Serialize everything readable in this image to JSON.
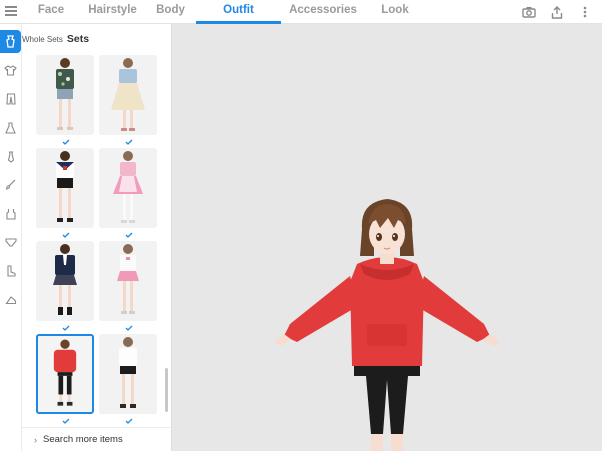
{
  "tabs": [
    "Face",
    "Hairstyle",
    "Body",
    "Outfit",
    "Accessories",
    "Look"
  ],
  "active_tab": "Outfit",
  "toolbar": {
    "menu_icon": "hamburger-menu-icon",
    "camera_icon": "camera-icon",
    "share_icon": "share-icon",
    "more_icon": "more-vertical-icon"
  },
  "rail": {
    "items": [
      "sets-icon",
      "shirt-icon",
      "pants-icon",
      "dress-icon",
      "tie-icon",
      "brush-icon",
      "tank-top-icon",
      "underwear-icon",
      "boots-icon",
      "shoes-icon"
    ],
    "active_index": 0
  },
  "panel": {
    "breadcrumb": "Whole Sets",
    "title": "Sets",
    "search_more": "Search more items",
    "items": [
      {
        "name": "floral-shirt-shorts",
        "selected": false
      },
      {
        "name": "denim-jacket-cream-skirt",
        "selected": false
      },
      {
        "name": "sailor-uniform-black-shorts",
        "selected": false
      },
      {
        "name": "pink-maid-dress",
        "selected": false
      },
      {
        "name": "navy-blazer-plaid-skirt",
        "selected": false
      },
      {
        "name": "white-top-pink-skirt",
        "selected": false
      },
      {
        "name": "red-hoodie-black-leggings",
        "selected": true
      },
      {
        "name": "white-tee-black-shorts",
        "selected": false
      }
    ]
  },
  "colors": {
    "accent": "#1e88e5",
    "viewport_bg": "#e7e7e7",
    "hoodie": "#e23b3b",
    "hair": "#6a4428"
  }
}
